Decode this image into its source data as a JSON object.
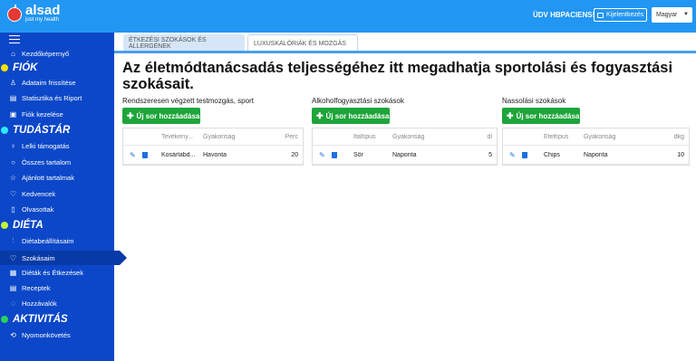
{
  "brand": {
    "name": "alsad",
    "tagline": "just my health"
  },
  "header": {
    "welcome": "ÜDV HBPACIENS!",
    "logout": "Kijelentkezés",
    "language": "Magyar"
  },
  "sidebar": {
    "home": "Kezdőképernyő",
    "sections": [
      {
        "title": "FIÓK",
        "color": "#f5e400",
        "items": [
          "Adataim frissítése",
          "Statisztika és Riport",
          "Fiók kezelése"
        ]
      },
      {
        "title": "TUDÁSTÁR",
        "color": "#2ee8ff",
        "items": [
          "Lelki támogatás",
          "Összes tartalom",
          "Ajánlott tartalmak",
          "Kedvencek",
          "Olvasottak"
        ]
      },
      {
        "title": "DIÉTA",
        "color": "#c3f53a",
        "items": [
          "Diétabeállításaim",
          "Szokásaim",
          "Diéták és Étkezések",
          "Receptek",
          "Hozzávalók"
        ]
      },
      {
        "title": "AKTIVITÁS",
        "color": "#2bd15b",
        "items": [
          "Nyomonkövetés"
        ]
      }
    ],
    "active_item": "Szokásaim"
  },
  "tabs": [
    "ÉTKEZÉSI SZOKÁSOK ÉS ALLERGÉNEK",
    "LUXUSKALÓRIÁK ÉS MOZGÁS"
  ],
  "title": "Az életmódtanácsadás teljességéhez itt megadhatja sportolási és fogyasztási szokásait.",
  "add_label": "Új sor hozzáadása",
  "panels": [
    {
      "label": "Rendszeresen végzett testmozgás, sport",
      "headers": [
        "Tevékeny...",
        "Gyakoriság",
        "Perc"
      ],
      "row": [
        "Kosárlabd...",
        "Havonta",
        "20"
      ]
    },
    {
      "label": "Alkoholfogyasztási szokások",
      "headers": [
        "Italtípus",
        "Gyakoriság",
        "dl"
      ],
      "row": [
        "Sör",
        "Naponta",
        "5"
      ]
    },
    {
      "label": "Nassolási szokások",
      "headers": [
        "Ételtípus",
        "Gyakoriság",
        "dkg"
      ],
      "row": [
        "Chips",
        "Naponta",
        "10"
      ]
    }
  ]
}
